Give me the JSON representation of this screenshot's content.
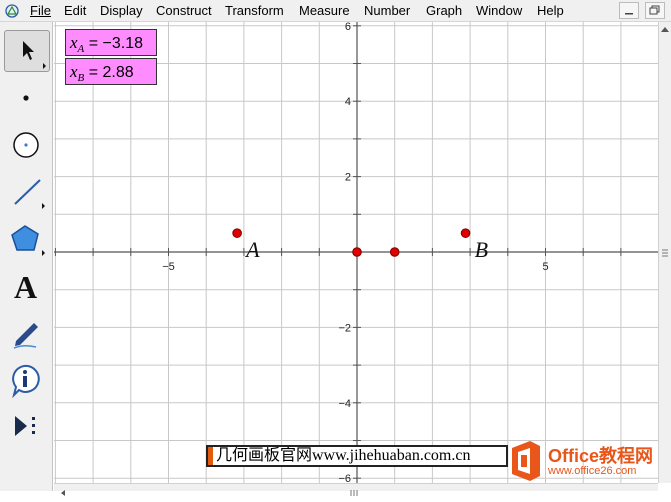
{
  "menu": {
    "items": [
      {
        "label": "File"
      },
      {
        "label": "Edit"
      },
      {
        "label": "Display"
      },
      {
        "label": "Construct"
      },
      {
        "label": "Transform"
      },
      {
        "label": "Measure"
      },
      {
        "label": "Number"
      },
      {
        "label": "Graph"
      },
      {
        "label": "Window"
      },
      {
        "label": "Help"
      }
    ]
  },
  "toolbox": {
    "tools": [
      {
        "name": "arrow-tool-icon"
      },
      {
        "name": "point-tool-icon"
      },
      {
        "name": "compass-tool-icon"
      },
      {
        "name": "straightedge-tool-icon"
      },
      {
        "name": "polygon-tool-icon"
      },
      {
        "name": "text-tool-icon"
      },
      {
        "name": "marker-tool-icon"
      },
      {
        "name": "information-tool-icon"
      },
      {
        "name": "custom-tool-icon"
      }
    ],
    "text_tool_glyph": "A"
  },
  "measurements": [
    {
      "var": "x",
      "sub": "A",
      "text": " = −3.18",
      "value": -3.18
    },
    {
      "var": "x",
      "sub": "B",
      "text": " = 2.88",
      "value": 2.88
    }
  ],
  "graph": {
    "x_ticks": [
      {
        "label": "−5",
        "value": -5
      },
      {
        "label": "5",
        "value": 5
      }
    ],
    "y_ticks": [
      {
        "label": "6",
        "value": 6
      },
      {
        "label": "4",
        "value": 4
      },
      {
        "label": "2",
        "value": 2
      },
      {
        "label": "−2",
        "value": -2
      },
      {
        "label": "−4",
        "value": -4
      },
      {
        "label": "−6",
        "value": -6
      }
    ],
    "points": [
      {
        "label": "A",
        "x": -3.18,
        "y": 0.5
      },
      {
        "label": "B",
        "x": 2.88,
        "y": 0.5
      },
      {
        "label": "",
        "x": 0,
        "y": 0
      },
      {
        "label": "",
        "x": 1,
        "y": 0
      }
    ],
    "grid": true,
    "point_color": "#e00000"
  },
  "watermark": {
    "banner": "几何画板官网www.jihehuaban.com.cn",
    "logo_title": "Office教程网",
    "logo_url": "www.office26.com"
  },
  "colors": {
    "measure_bg": "#ff8cff",
    "brand_orange": "#e8561a"
  }
}
